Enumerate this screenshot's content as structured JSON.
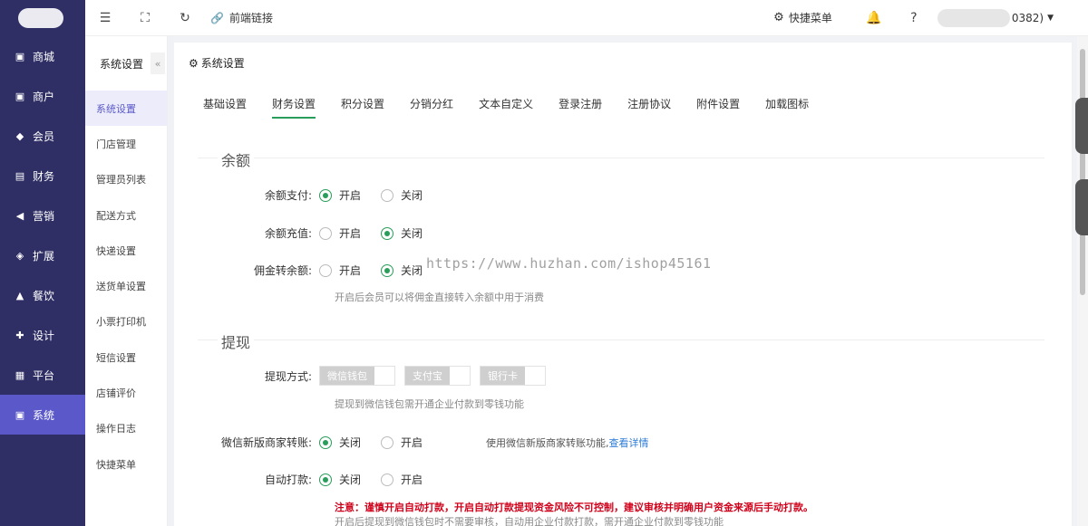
{
  "nav": {
    "items": [
      {
        "label": "商城",
        "icon": "monitor-icon"
      },
      {
        "label": "商户",
        "icon": "store-icon"
      },
      {
        "label": "会员",
        "icon": "diamond-icon"
      },
      {
        "label": "财务",
        "icon": "wallet-icon"
      },
      {
        "label": "营销",
        "icon": "megaphone-icon"
      },
      {
        "label": "扩展",
        "icon": "cube-icon"
      },
      {
        "label": "餐饮",
        "icon": "dish-icon"
      },
      {
        "label": "设计",
        "icon": "puzzle-icon"
      },
      {
        "label": "平台",
        "icon": "grid-icon"
      },
      {
        "label": "系统",
        "icon": "system-icon",
        "active": true
      }
    ]
  },
  "subnav": {
    "title": "系统设置",
    "collapse_glyph": "«",
    "items": [
      {
        "label": "系统设置",
        "active": true
      },
      {
        "label": "门店管理"
      },
      {
        "label": "管理员列表"
      },
      {
        "label": "配送方式"
      },
      {
        "label": "快递设置"
      },
      {
        "label": "送货单设置"
      },
      {
        "label": "小票打印机"
      },
      {
        "label": "短信设置"
      },
      {
        "label": "店铺评价"
      },
      {
        "label": "操作日志"
      },
      {
        "label": "快捷菜单"
      }
    ]
  },
  "topbar": {
    "frontend_link": "前端链接",
    "quick_menu": "快捷菜单",
    "user_suffix": "0382)"
  },
  "card": {
    "title": "系统设置",
    "tabs": [
      "基础设置",
      "财务设置",
      "积分设置",
      "分销分红",
      "文本自定义",
      "登录注册",
      "注册协议",
      "附件设置",
      "加载图标"
    ],
    "active_tab": 1
  },
  "balance": {
    "section": "余额",
    "pay_label": "余额支付:",
    "recharge_label": "余额充值:",
    "commission_label": "佣金转余额:",
    "open": "开启",
    "close": "关闭",
    "commission_hint": "开启后会员可以将佣金直接转入余额中用于消费"
  },
  "withdraw": {
    "section": "提现",
    "method_label": "提现方式:",
    "methods": [
      "微信钱包",
      "支付宝",
      "银行卡"
    ],
    "method_hint": "提现到微信钱包需开通企业付款到零钱功能",
    "wechat_label": "微信新版商家转账:",
    "close": "关闭",
    "open": "开启",
    "wechat_note": "使用微信新版商家转账功能,",
    "wechat_link": "查看详情",
    "auto_label": "自动打款:",
    "warning": "注意：谨慎开启自动打款，开启自动打款提现资金风险不可控制，建议审核并明确用户资金来源后手动打款。",
    "auto_hint": "开启后提现到微信钱包时不需要审核，自动用企业付款打款，需开通企业付款到零钱功能"
  },
  "watermark": "https://www.huzhan.com/ishop45161",
  "colors": {
    "sidebar": "#2f2f66",
    "sidebar_active": "#5b59c9",
    "accent_green": "#2a9c5c",
    "link_blue": "#2d7bd6",
    "warning_red": "#d0021b"
  }
}
